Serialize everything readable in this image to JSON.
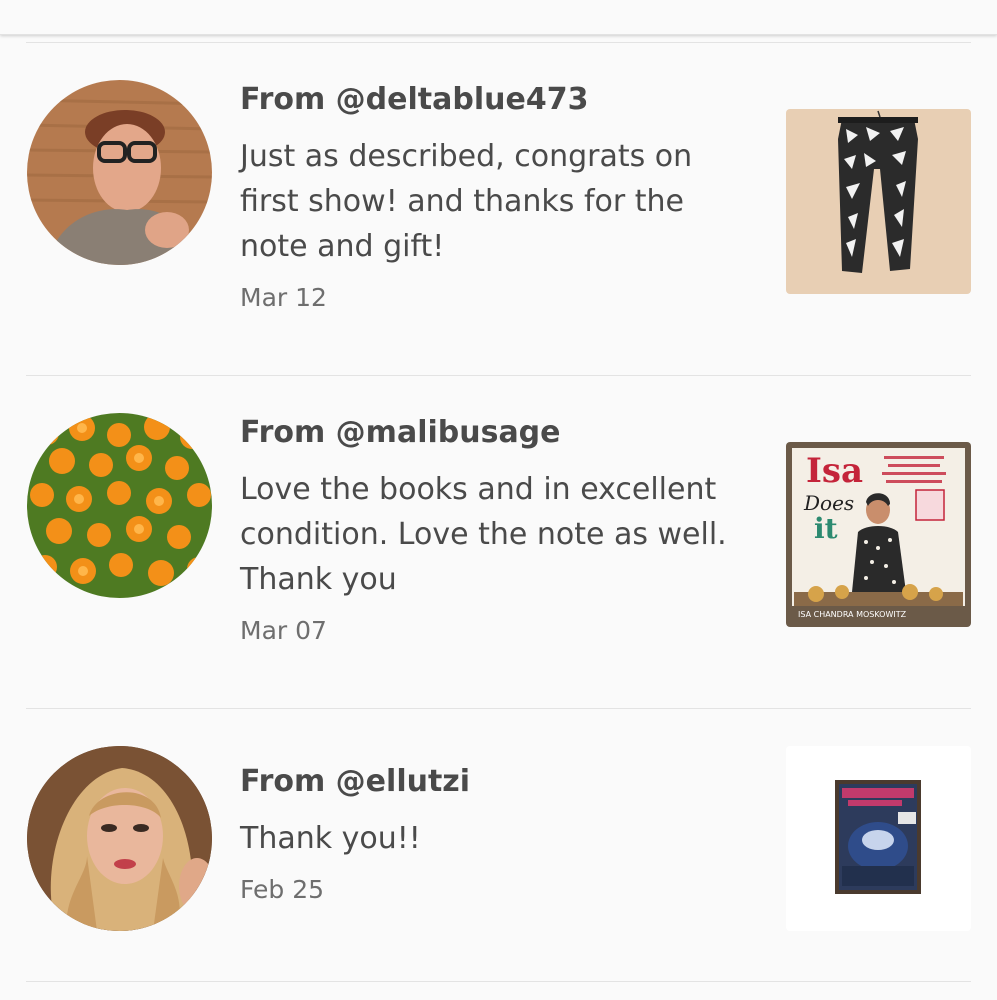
{
  "reviews": [
    {
      "from": "From @deltablue473",
      "message_lines": [
        "Just as described, congrats on",
        "first show! and thanks for the",
        "note and gift!"
      ],
      "date": "Mar 12",
      "avatar_icon": "user-photo-glasses",
      "item_icon": "patterned-leggings"
    },
    {
      "from": "From @malibusage",
      "message_lines": [
        "Love the books and in excellent",
        "condition. Love the note as well.",
        "Thank you"
      ],
      "date": "Mar 07",
      "avatar_icon": "orange-poppies-photo",
      "item_icon": "cookbook-cover",
      "item_cover": {
        "title_1": "Isa",
        "title_2": "Does",
        "title_3": "it",
        "author": "ISA CHANDRA MOSKOWITZ"
      }
    },
    {
      "from": "From @ellutzi",
      "message_lines": [
        "Thank you!!"
      ],
      "date": "Feb 25",
      "avatar_icon": "user-photo-blonde",
      "item_icon": "bagged-hat"
    }
  ],
  "colors": {
    "background": "#fafafa",
    "text": "#4a4a4a",
    "date": "#6e6e6e",
    "divider": "#e3e3e3"
  }
}
